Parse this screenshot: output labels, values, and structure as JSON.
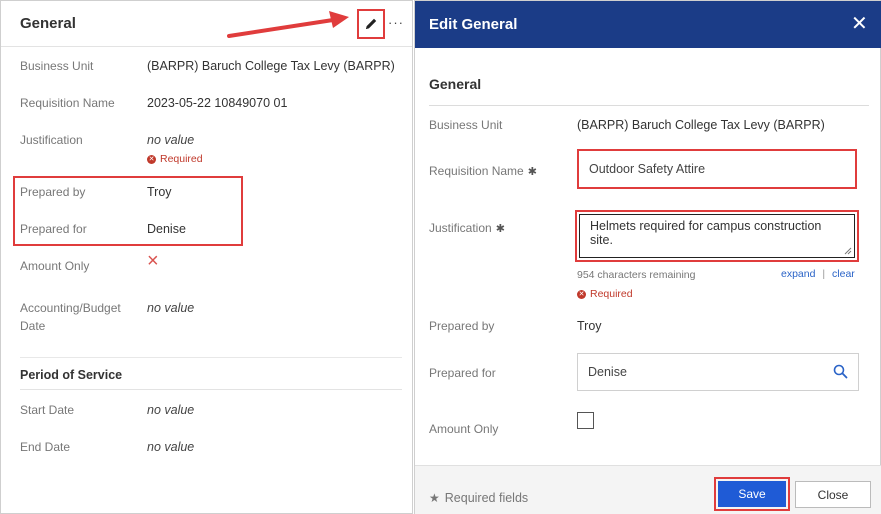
{
  "left": {
    "title": "General",
    "more": "···",
    "rows": [
      {
        "label": "Business Unit",
        "value": "(BARPR) Baruch College Tax Levy (BARPR)"
      },
      {
        "label": "Requisition Name",
        "value": "2023-05-22 10849070 01"
      },
      {
        "label": "Justification",
        "value": "no value",
        "required": "Required"
      },
      {
        "label": "Prepared by",
        "value": "Troy"
      },
      {
        "label": "Prepared for",
        "value": "Denise"
      },
      {
        "label": "Amount Only",
        "value": "×"
      },
      {
        "label_line1": "Accounting/Budget",
        "label_line2": "Date",
        "value": "no value"
      }
    ],
    "section_title": "Period of Service",
    "start_date": {
      "label": "Start Date",
      "value": "no value"
    },
    "end_date": {
      "label": "End Date",
      "value": "no value"
    }
  },
  "modal": {
    "title": "Edit General",
    "section_title": "General",
    "business_unit": {
      "label": "Business Unit",
      "value": "(BARPR) Baruch College Tax Levy (BARPR)"
    },
    "requisition_name": {
      "label": "Requisition Name",
      "value": "Outdoor Safety Attire"
    },
    "justification": {
      "label": "Justification",
      "value": "Helmets required for campus construction site."
    },
    "chars_remaining": "954 characters remaining",
    "expand": "expand",
    "separator": "|",
    "clear": "clear",
    "required": "Required",
    "prepared_by": {
      "label": "Prepared by",
      "value": "Troy"
    },
    "prepared_for": {
      "label": "Prepared for",
      "value": "Denise"
    },
    "amount_only": {
      "label": "Amount Only"
    },
    "required_fields": "Required fields",
    "save_label": "Save",
    "close_label": "Close"
  },
  "colors": {
    "header_bg": "#1b3c87",
    "save_bg": "#1f5bd6",
    "highlight": "#e03c3c",
    "error": "#c0392b"
  }
}
